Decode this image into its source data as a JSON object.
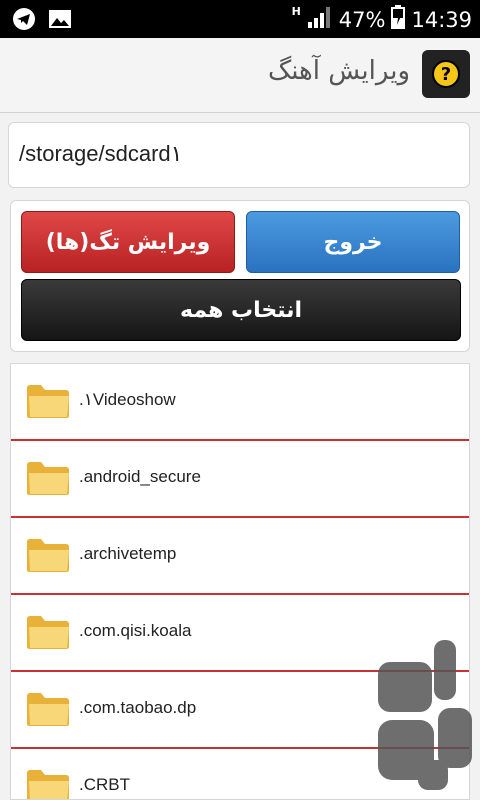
{
  "status_bar": {
    "network_type": "H",
    "battery": "47%",
    "time": "14:39",
    "left_icons": [
      "telegram-icon",
      "image-icon"
    ]
  },
  "action_bar": {
    "title": "ویرایش آهنگ",
    "app_icon": "help-icon",
    "app_icon_glyph": "?"
  },
  "path": {
    "value": "/storage/sdcard۱"
  },
  "buttons": {
    "exit": "خروج",
    "edit_tags": "ویرایش تگ(ها)",
    "select_all": "انتخاب همه"
  },
  "files": [
    {
      "name": ".۱Videoshow"
    },
    {
      "name": ".android_secure"
    },
    {
      "name": ".archivetemp"
    },
    {
      "name": ".com.qisi.koala"
    },
    {
      "name": ".com.taobao.dp"
    },
    {
      "name": ".CRBT"
    }
  ],
  "colors": {
    "exit_button": "#2f7fcf",
    "edit_button": "#c72a2a",
    "select_all_button": "#222222",
    "row_divider": "#c83232",
    "folder": "#f5c64a"
  }
}
